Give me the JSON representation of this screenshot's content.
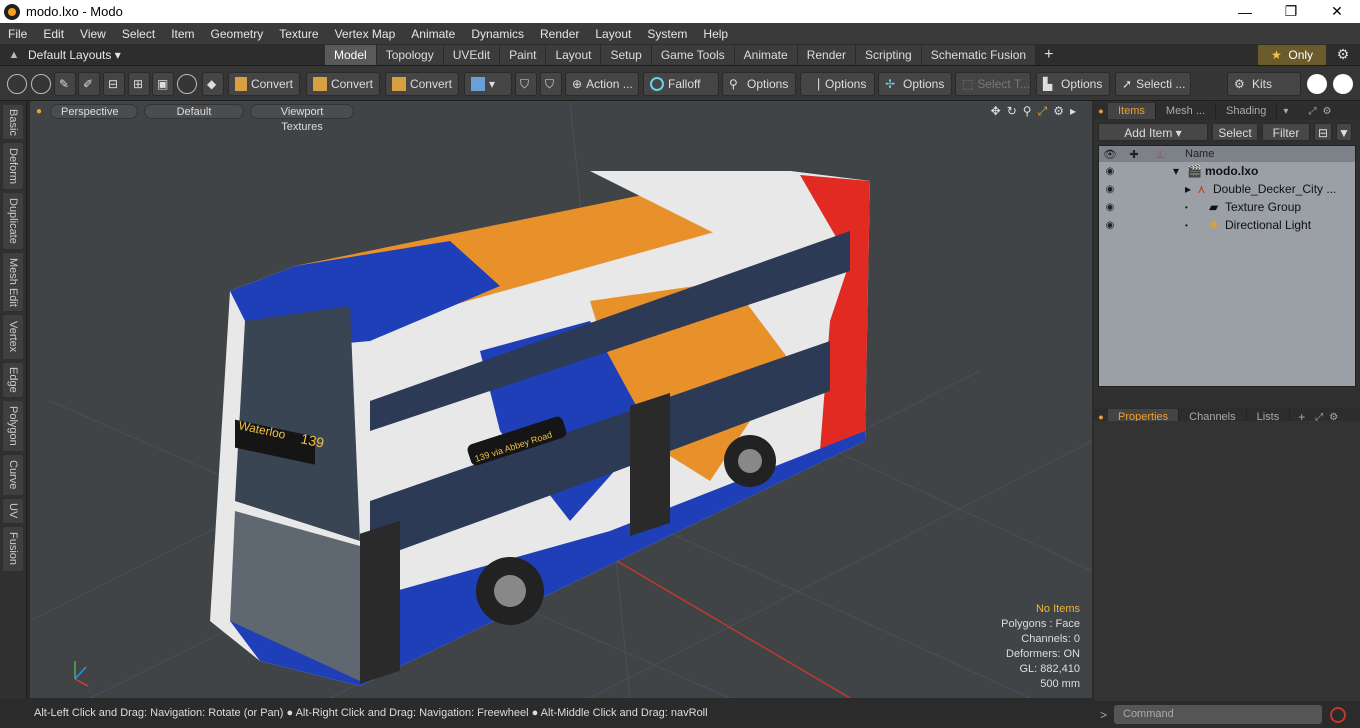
{
  "window": {
    "title": "modo.lxo - Modo",
    "minimize": "—",
    "maximize": "❐",
    "close": "✕"
  },
  "menu": [
    "File",
    "Edit",
    "View",
    "Select",
    "Item",
    "Geometry",
    "Texture",
    "Vertex Map",
    "Animate",
    "Dynamics",
    "Render",
    "Layout",
    "System",
    "Help"
  ],
  "layout_selector": "Default Layouts ▾",
  "tabs": [
    "Model",
    "Topology",
    "UVEdit",
    "Paint",
    "Layout",
    "Setup",
    "Game Tools",
    "Animate",
    "Render",
    "Scripting",
    "Schematic Fusion"
  ],
  "active_tab": "Model",
  "only_label": "Only",
  "toolbar": {
    "convert1": "Convert",
    "convert2": "Convert",
    "convert3": "Convert",
    "action": "Action ...",
    "falloff": "Falloff",
    "options1": "Options",
    "options2": "Options",
    "options3": "Options",
    "select_t": "Select T...",
    "options4": "Options",
    "selecti": "Selecti ...",
    "kits": "Kits"
  },
  "left_tabs": [
    "Basic",
    "Deform",
    "Duplicate",
    "Mesh Edit",
    "Vertex",
    "Edge",
    "Polygon",
    "Curve",
    "UV",
    "Fusion"
  ],
  "viewport": {
    "view_mode": "Perspective",
    "shading": "Default",
    "textures": "Viewport Textures",
    "bus_destination": "Waterloo",
    "bus_route": "139",
    "bus_side_sign": "139 via Abbey Road",
    "stats": {
      "no_items": "No Items",
      "polygons": "Polygons : Face",
      "channels": "Channels: 0",
      "deformers": "Deformers: ON",
      "gl": "GL: 882,410",
      "scale": "500 mm"
    }
  },
  "status_bar": "Alt-Left Click and Drag: Navigation: Rotate (or Pan) ● Alt-Right Click and Drag: Navigation: Freewheel ● Alt-Middle Click and Drag: navRoll",
  "right_panel": {
    "tabs": [
      "Items",
      "Mesh ...",
      "Shading"
    ],
    "add_item": "Add Item",
    "select": "Select",
    "filter": "Filter",
    "name_header": "Name",
    "items": [
      "modo.lxo",
      "Double_Decker_City ...",
      "Texture Group",
      "Directional Light"
    ],
    "bottom_tabs": [
      "Properties",
      "Channels",
      "Lists"
    ],
    "command_placeholder": "Command"
  },
  "colors": {
    "accent": "#f0a030",
    "bus_red": "#e02a22",
    "bus_blue": "#1e3fb8",
    "bus_orange": "#e8902a"
  }
}
